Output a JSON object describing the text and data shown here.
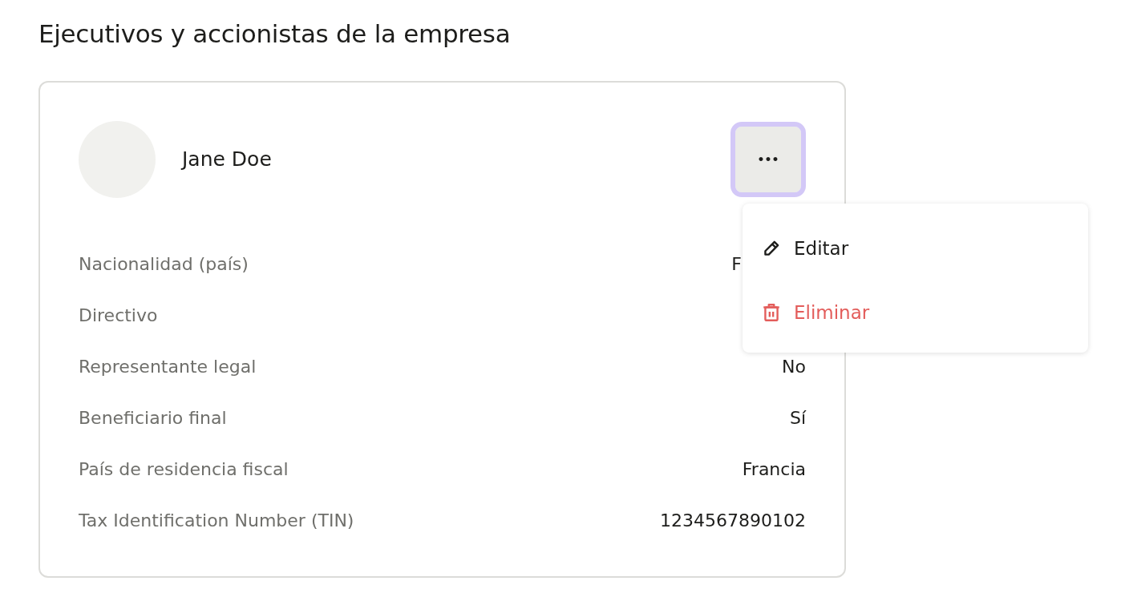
{
  "heading": "Ejecutivos y accionistas de la empresa",
  "person": {
    "name": "Jane Doe"
  },
  "more_button": {
    "label": "•••",
    "focused": true
  },
  "menu": {
    "items": [
      {
        "label": "Editar",
        "kind": "edit"
      },
      {
        "label": "Eliminar",
        "kind": "delete"
      }
    ]
  },
  "details": [
    {
      "label": "Nacionalidad (país)",
      "value": "F",
      "covered": true
    },
    {
      "label": "Directivo"
    },
    {
      "label": "Representante legal",
      "value": "No"
    },
    {
      "label": "Beneficiario final",
      "value": "Sí"
    },
    {
      "label": "País de residencia fiscal",
      "value": "Francia"
    },
    {
      "label": "Tax Identification Number (TIN)",
      "value": "1234567890102"
    }
  ]
}
